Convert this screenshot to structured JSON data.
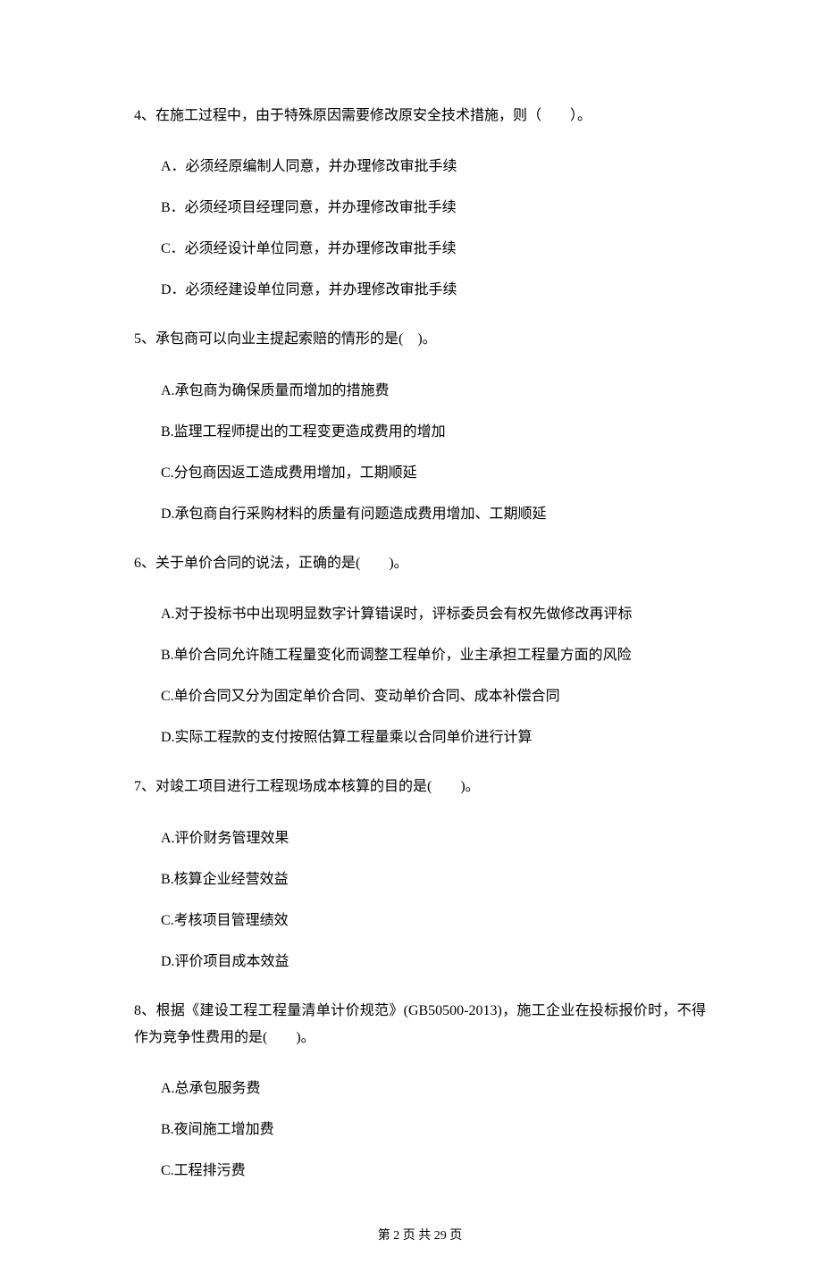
{
  "questions": [
    {
      "stem": "4、在施工过程中，由于特殊原因需要修改原安全技术措施，则（　　）。",
      "options": [
        "A．必须经原编制人同意，并办理修改审批手续",
        "B．必须经项目经理同意，并办理修改审批手续",
        "C．必须经设计单位同意，并办理修改审批手续",
        "D．必须经建设单位同意，并办理修改审批手续"
      ]
    },
    {
      "stem": "5、承包商可以向业主提起索赔的情形的是(　)。",
      "options": [
        "A.承包商为确保质量而增加的措施费",
        "B.监理工程师提出的工程变更造成费用的增加",
        "C.分包商因返工造成费用增加，工期顺延",
        "D.承包商自行采购材料的质量有问题造成费用增加、工期顺延"
      ]
    },
    {
      "stem": "6、关于单价合同的说法，正确的是(　　)。",
      "options": [
        "A.对于投标书中出现明显数字计算错误时，评标委员会有权先做修改再评标",
        "B.单价合同允许随工程量变化而调整工程单价，业主承担工程量方面的风险",
        "C.单价合同又分为固定单价合同、变动单价合同、成本补偿合同",
        "D.实际工程款的支付按照估算工程量乘以合同单价进行计算"
      ]
    },
    {
      "stem": "7、对竣工项目进行工程现场成本核算的目的是(　　)。",
      "options": [
        "A.评价财务管理效果",
        "B.核算企业经营效益",
        "C.考核项目管理绩效",
        "D.评价项目成本效益"
      ]
    },
    {
      "stem": "8、根据《建设工程工程量清单计价规范》(GB50500-2013)，施工企业在投标报价时，不得作为竞争性费用的是(　　)。",
      "options": [
        "A.总承包服务费",
        "B.夜间施工增加费",
        "C.工程排污费"
      ]
    }
  ],
  "footer": "第 2 页 共 29 页"
}
